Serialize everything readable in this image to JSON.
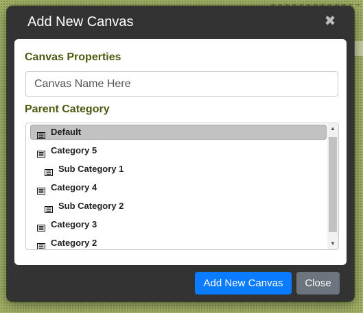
{
  "dialog": {
    "title": "Add New Canvas",
    "close_glyph": "✖"
  },
  "form": {
    "properties_label": "Canvas Properties",
    "name_input": {
      "value": "",
      "placeholder": "Canvas Name Here"
    },
    "parent_label": "Parent Category"
  },
  "category_list": {
    "icon": "list-icon",
    "items": [
      {
        "label": "Default",
        "level": 0,
        "selected": true
      },
      {
        "label": "Category 5",
        "level": 0,
        "selected": false
      },
      {
        "label": "Sub Category 1",
        "level": 1,
        "selected": false
      },
      {
        "label": "Category 4",
        "level": 0,
        "selected": false
      },
      {
        "label": "Sub Category 2",
        "level": 1,
        "selected": false
      },
      {
        "label": "Category 3",
        "level": 0,
        "selected": false
      },
      {
        "label": "Category 2",
        "level": 0,
        "selected": false
      }
    ]
  },
  "footer": {
    "primary_label": "Add New Canvas",
    "secondary_label": "Close"
  },
  "colors": {
    "accent": "#0a7cff",
    "section_label": "#4a5a10",
    "modal_bg": "#333333",
    "selected_item_bg": "#c2c2c2"
  }
}
